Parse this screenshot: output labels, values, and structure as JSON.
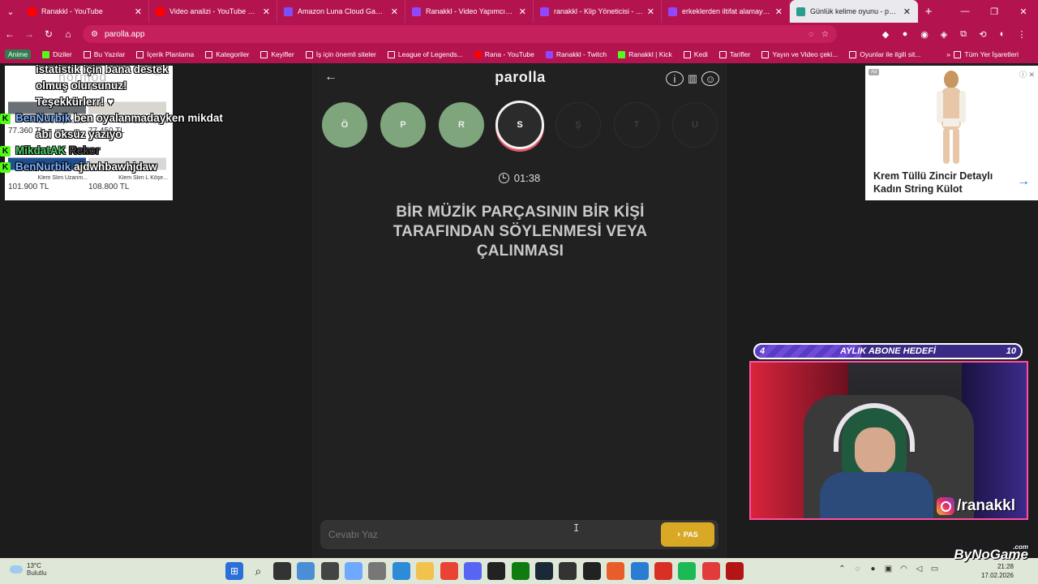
{
  "browser": {
    "tabs": [
      {
        "title": "Ranakkl - YouTube",
        "color": "#ff0000"
      },
      {
        "title": "Video analizi - YouTube Studio",
        "color": "#ff0000"
      },
      {
        "title": "Amazon Luna Cloud Gaming",
        "color": "#7b4fff"
      },
      {
        "title": "Ranakkl - Video Yapımcısı - Twitch",
        "color": "#9146ff"
      },
      {
        "title": "ranakkl - Klip Yöneticisi - Twitch",
        "color": "#9146ff"
      },
      {
        "title": "erkeklerden iltifat alamayan ranakkl",
        "color": "#9146ff"
      },
      {
        "title": "Günlük kelime oyunu - parolla",
        "color": "#2a9d8f"
      }
    ],
    "url": "parolla.app",
    "bookmarks": [
      {
        "label": "Anime",
        "kind": "text"
      },
      {
        "label": "Diziler",
        "kind": "kick"
      },
      {
        "label": "Bu Yazılar",
        "kind": "folder"
      },
      {
        "label": "İçerik Planlama",
        "kind": "folder"
      },
      {
        "label": "Kategoriler",
        "kind": "folder"
      },
      {
        "label": "Keyifler",
        "kind": "folder"
      },
      {
        "label": "İş için önemli siteler",
        "kind": "folder"
      },
      {
        "label": "League of Legends...",
        "kind": "folder"
      },
      {
        "label": "Rana - YouTube",
        "kind": "yt"
      },
      {
        "label": "Ranakkl - Twitch",
        "kind": "tw"
      },
      {
        "label": "Ranakkl | Kick",
        "kind": "kick"
      },
      {
        "label": "Kedi",
        "kind": "folder"
      },
      {
        "label": "Tarifler",
        "kind": "folder"
      },
      {
        "label": "Yayın ve Video çeki...",
        "kind": "folder"
      },
      {
        "label": "Oyunlar ile ilgili sit...",
        "kind": "folder"
      }
    ],
    "bookmarks_more": "»",
    "bookmarks_all": "Tüm Yer İşaretleri"
  },
  "game": {
    "title": "parolla",
    "letters": [
      {
        "letter": "Ö",
        "state": "done"
      },
      {
        "letter": "P",
        "state": "done"
      },
      {
        "letter": "R",
        "state": "done"
      },
      {
        "letter": "S",
        "state": "current"
      },
      {
        "letter": "Ş",
        "state": "pending"
      },
      {
        "letter": "T",
        "state": "pending"
      },
      {
        "letter": "U",
        "state": "pending"
      }
    ],
    "timer": "01:38",
    "question": "BİR MÜZİK PARÇASININ BİR KİŞİ TARAFINDAN SÖYLENMESİ VEYA ÇALINMASI",
    "answer_placeholder": "Cevabı Yaz",
    "pass_label": "PAS"
  },
  "ad_left": {
    "brand": "normod",
    "products": [
      {
        "name": "Klem L Köşe Koltu...",
        "price": "77.360 TL",
        "color": "#6b7077"
      },
      {
        "name": "Klem Slim L Köşe...",
        "price": "77.450 TL",
        "color": "#d9d6cf"
      },
      {
        "name": "Klem Slim Uzanm...",
        "price": "101.900 TL",
        "color": "#1f4f8f"
      },
      {
        "name": "Klem Slim L Köşe...",
        "price": "108.800 TL",
        "color": "#d8d8d8"
      }
    ]
  },
  "ad_right": {
    "badge": "Ad",
    "title": "Krem Tüllü Zincir Detaylı Kadın String Külot"
  },
  "chat": {
    "lines": [
      {
        "user": "",
        "text": "istatistik için bana destek"
      },
      {
        "user": "",
        "text": "olmuş olursunuz!"
      },
      {
        "user": "",
        "text": "Teşekkürlerr! ♥"
      },
      {
        "user": "BenNurbik",
        "text": "ben oyalanmadayken mikdat"
      },
      {
        "user": "",
        "text": "abi öksüz yazıyo"
      },
      {
        "user": "MikdatAK",
        "text": "Rekor"
      },
      {
        "user": "BenNurbik",
        "text": "ajdwhbawhjdaw"
      }
    ]
  },
  "stream": {
    "sub_goal_current": "4",
    "sub_goal_label": "AYLIK ABONE HEDEFİ",
    "sub_goal_target": "10",
    "sub_goal_fraction": 0.4,
    "instagram": "/ranakkl",
    "watermark": "ByNoGame",
    "watermark_tld": ".com"
  },
  "taskbar": {
    "temp": "13°C",
    "weather": "Bulutlu",
    "time": "21:28",
    "date": "17.02.2026",
    "apps": [
      {
        "name": "start-icon",
        "color": "#2b6fd8"
      },
      {
        "name": "search-icon",
        "color": "transparent"
      },
      {
        "name": "task-view-icon",
        "color": "#333"
      },
      {
        "name": "app-icon-1",
        "color": "#4a8fd6"
      },
      {
        "name": "app-icon-2",
        "color": "#444"
      },
      {
        "name": "copilot-icon",
        "color": "#6fa8ff"
      },
      {
        "name": "settings-icon",
        "color": "#777"
      },
      {
        "name": "photos-icon",
        "color": "#2e8bd8"
      },
      {
        "name": "explorer-icon",
        "color": "#f2c14e"
      },
      {
        "name": "chrome-icon",
        "color": "#e94335"
      },
      {
        "name": "discord-icon",
        "color": "#5865f2"
      },
      {
        "name": "app-icon-3",
        "color": "#222"
      },
      {
        "name": "xbox-icon",
        "color": "#107c10"
      },
      {
        "name": "steam-icon",
        "color": "#1b2838"
      },
      {
        "name": "obs-icon",
        "color": "#333"
      },
      {
        "name": "epic-icon",
        "color": "#222"
      },
      {
        "name": "app-icon-4",
        "color": "#e85d2a"
      },
      {
        "name": "app-icon-5",
        "color": "#2b7cd3"
      },
      {
        "name": "app-icon-6",
        "color": "#d93025"
      },
      {
        "name": "spotify-icon",
        "color": "#1db954"
      },
      {
        "name": "app-icon-7",
        "color": "#e23b3b"
      },
      {
        "name": "app-icon-8",
        "color": "#b31414"
      }
    ]
  }
}
